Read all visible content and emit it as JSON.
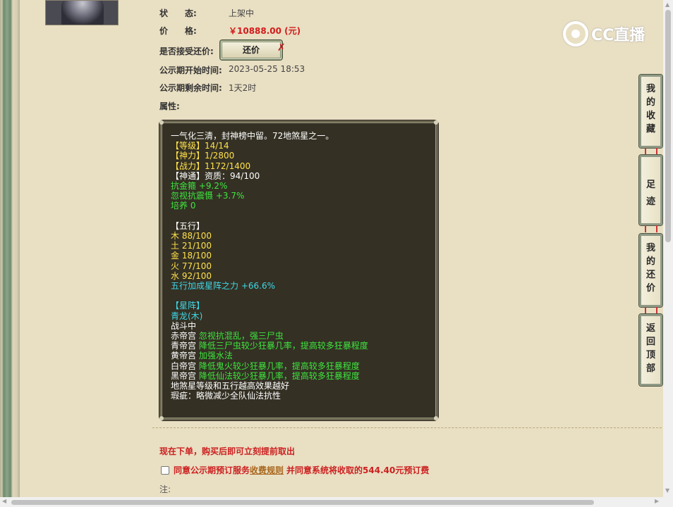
{
  "status": {
    "label": "状　　态:",
    "value": "上架中"
  },
  "price": {
    "label": "价　　格:",
    "value": "￥10888.00 (元)"
  },
  "bargain": {
    "label": "是否接受还价:",
    "button": "还价",
    "mark": "✗"
  },
  "publicity_start": {
    "label": "公示期开始时间:",
    "value": "2023-05-25 18:53"
  },
  "publicity_remaining": {
    "label": "公示期剩余时间:",
    "value": "1天2时"
  },
  "attributes": {
    "label": "属性:",
    "lines": [
      {
        "text": "一气化三清，封神榜中留。72地煞星之一。",
        "color": "w"
      },
      {
        "text": "【等级】14/14",
        "color": "y"
      },
      {
        "text": "【神力】1/2800",
        "color": "y"
      },
      {
        "text": "【战力】1172/1400",
        "color": "y"
      },
      {
        "text": "【神通】资质：94/100",
        "color": "w"
      },
      {
        "text": "抗金箍 +9.2%",
        "color": "g"
      },
      {
        "text": "忽视抗震慑 +3.7%",
        "color": "g"
      },
      {
        "text": "培养 0",
        "color": "g"
      },
      {
        "text": "",
        "color": "w"
      },
      {
        "text": "【五行】",
        "color": "w"
      },
      {
        "text": "木 88/100",
        "color": "y"
      },
      {
        "text": "土 21/100",
        "color": "y"
      },
      {
        "text": "金 18/100",
        "color": "y"
      },
      {
        "text": "火 77/100",
        "color": "y"
      },
      {
        "text": "水 92/100",
        "color": "y"
      },
      {
        "text": "五行加成星阵之力 +66.6%",
        "color": "c"
      },
      {
        "text": "",
        "color": "w"
      },
      {
        "text": "【星阵】",
        "color": "c"
      },
      {
        "text": "青龙(木)",
        "color": "c"
      },
      {
        "text": "战斗中",
        "color": "w"
      },
      {
        "prefix": "赤帝宫 ",
        "text": "忽视抗混乱，强三尸虫",
        "color": "g"
      },
      {
        "prefix": "青帝宫 ",
        "text": "降低三尸虫较少狂暴几率，提高较多狂暴程度",
        "color": "g"
      },
      {
        "prefix": "黄帝宫 ",
        "text": "加强水法",
        "color": "g"
      },
      {
        "prefix": "白帝宫 ",
        "text": "降低鬼火较少狂暴几率，提高较多狂暴程度",
        "color": "g"
      },
      {
        "prefix": "黑帝宫 ",
        "text": "降低仙法较少狂暴几率，提高较多狂暴程度",
        "color": "g"
      },
      {
        "text": "地煞星等级和五行越高效果越好",
        "color": "w"
      },
      {
        "text": "瑕疵：略微减少全队仙法抗性",
        "color": "w"
      }
    ]
  },
  "notice": "现在下单，购买后即可立刻提前取出",
  "agree": {
    "before": "同意公示期预订服务",
    "link": "收费规则",
    "after": "并同意系统将收取的544.40元预订费"
  },
  "note": "注:",
  "logo": "CC直播",
  "side_nav": [
    {
      "label": "我的收藏"
    },
    {
      "label": "足迹"
    },
    {
      "label": "我的还价"
    },
    {
      "label": "返回顶部"
    }
  ],
  "colors": {
    "price": "#d21b1b",
    "panel_bg": "#343024",
    "text_yellow": "#ffe14a",
    "text_green": "#3ee63e",
    "text_cyan": "#3fd7e6"
  }
}
